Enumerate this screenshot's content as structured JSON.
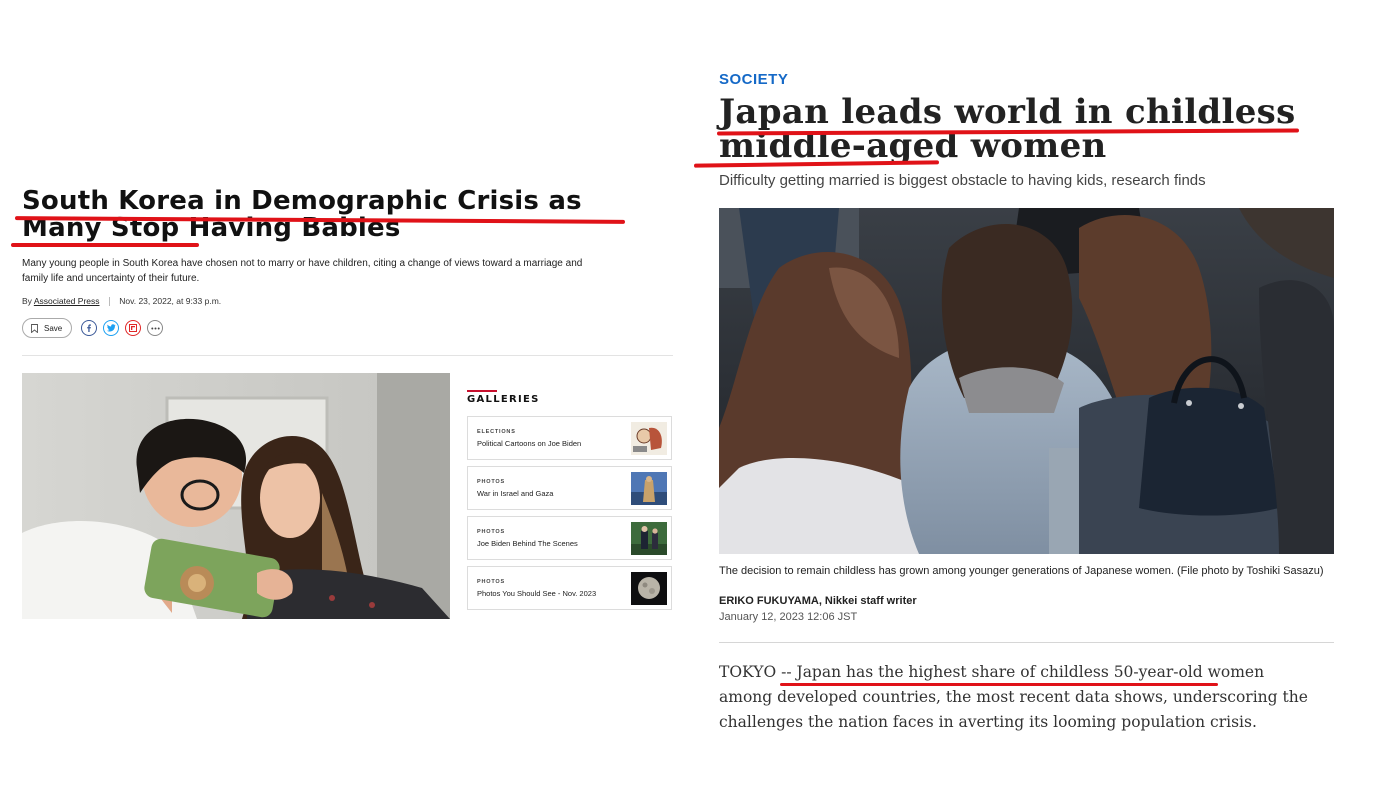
{
  "left_article": {
    "headline": "South Korea in Demographic Crisis as Many Stop Having Babies",
    "description": "Many young people in South Korea have chosen not to marry or have children, citing a change of views toward a marriage and family life and uncertainty of their future.",
    "byline_prefix": "By",
    "author": "Associated Press",
    "date": "Nov. 23, 2022, at 9:33 p.m.",
    "save_label": "Save",
    "share_icons": [
      "facebook-icon",
      "twitter-icon",
      "flipboard-icon",
      "more-icon"
    ],
    "galleries": {
      "title": "GALLERIES",
      "items": [
        {
          "category": "ELECTIONS",
          "title": "Political Cartoons on Joe Biden"
        },
        {
          "category": "PHOTOS",
          "title": "War in Israel and Gaza"
        },
        {
          "category": "PHOTOS",
          "title": "Joe Biden Behind The Scenes"
        },
        {
          "category": "PHOTOS",
          "title": "Photos You Should See - Nov. 2023"
        }
      ]
    }
  },
  "right_article": {
    "kicker": "SOCIETY",
    "headline": "Japan leads world in childless middle-aged women",
    "subheadline": "Difficulty getting married is biggest obstacle to having kids, research finds",
    "caption": "The decision to remain childless has grown among younger generations of Japanese women. (File photo by Toshiki Sasazu)",
    "author": "ERIKO FUKUYAMA, Nikkei staff writer",
    "date": "January 12, 2023 12:06 JST",
    "body": "TOKYO -- Japan has the highest share of childless 50-year-old women among developed countries, the most recent data shows, underscoring the challenges the nation faces in averting its looming population crisis."
  },
  "colors": {
    "annotation_red": "#e01218",
    "kicker_blue": "#1569c7",
    "gallery_accent": "#c8102e"
  }
}
